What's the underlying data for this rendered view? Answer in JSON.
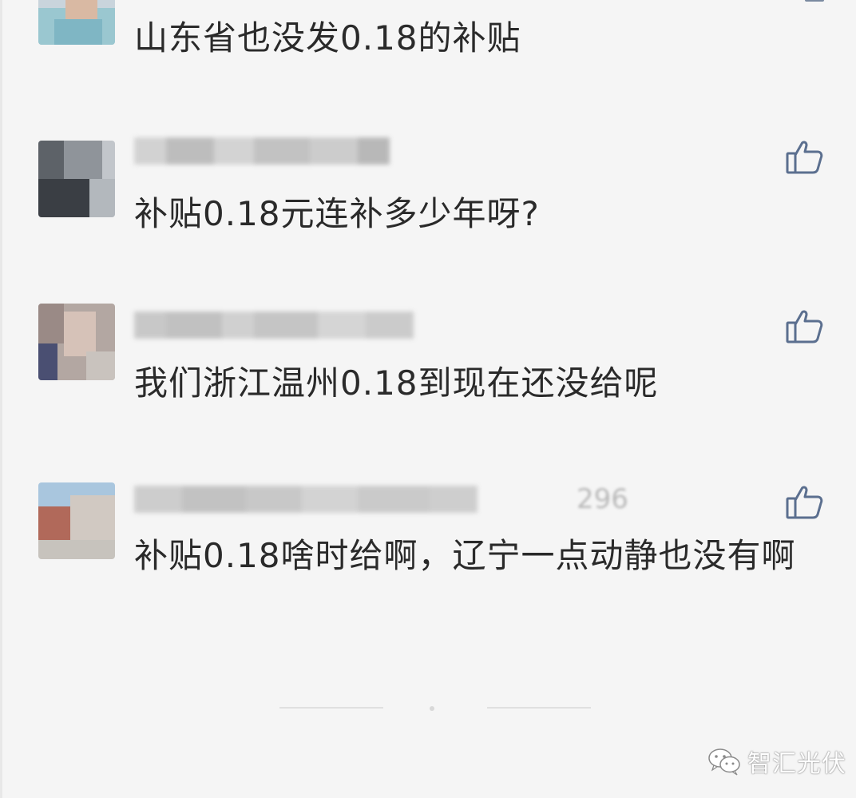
{
  "comments": [
    {
      "text": "山东省也没发0.18的补贴",
      "like_icon": "thumbs-up-icon"
    },
    {
      "text": "补贴0.18元连补多少年呀?",
      "like_icon": "thumbs-up-icon"
    },
    {
      "text": "我们浙江温州0.18到现在还没给呢",
      "like_icon": "thumbs-up-icon"
    },
    {
      "text": "补贴0.18啥时给啊，辽宁一点动静也没有啊",
      "name_fragment": "296",
      "like_icon": "thumbs-up-icon"
    }
  ],
  "watermark": {
    "text": "智汇光伏",
    "icon": "wechat-icon"
  },
  "colors": {
    "background": "#f5f5f5",
    "text": "#2a2a2a",
    "like_icon": "#5b6f8f"
  }
}
